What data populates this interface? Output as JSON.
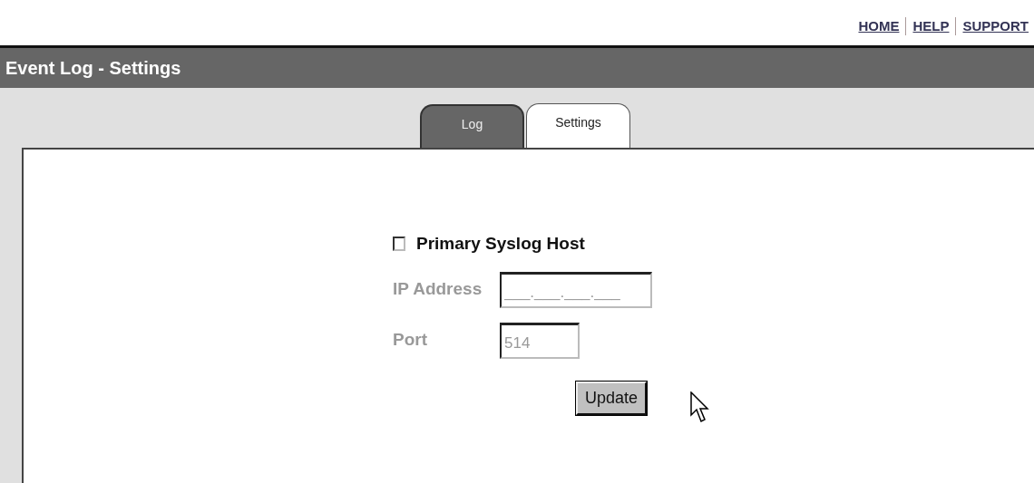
{
  "top_links": [
    "HOME",
    "HELP",
    "SUPPORT"
  ],
  "header": {
    "title": "Event Log - Settings"
  },
  "tabs": [
    {
      "label": "Log",
      "selected": false
    },
    {
      "label": "Settings",
      "selected": true
    }
  ],
  "syslog": {
    "label": "Primary Syslog Host",
    "checked": false,
    "fields": [
      {
        "label": "IP Address",
        "placeholder": "___.___.___.___",
        "disabled": true
      },
      {
        "label": "Port",
        "value": "514",
        "disabled": true
      }
    ],
    "button": "Update"
  }
}
